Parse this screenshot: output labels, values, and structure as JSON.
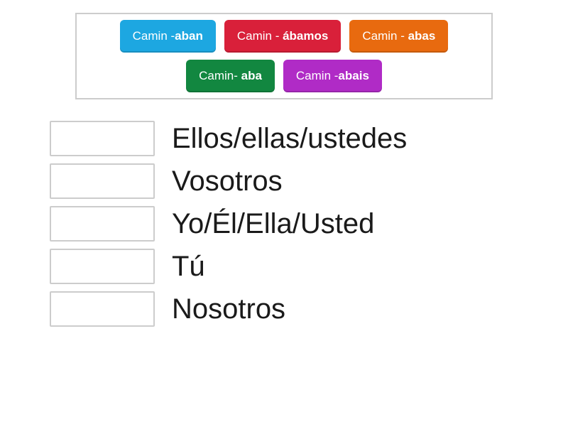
{
  "tiles": [
    {
      "prefix": "Camin -",
      "suffix": "aban",
      "color": "blue"
    },
    {
      "prefix": "Camin - ",
      "suffix": "ábamos",
      "color": "red"
    },
    {
      "prefix": "Camin - ",
      "suffix": "abas",
      "color": "orange"
    },
    {
      "prefix": "Camin- ",
      "suffix": "aba",
      "color": "green"
    },
    {
      "prefix": "Camin -",
      "suffix": "abais",
      "color": "purple"
    }
  ],
  "prompts": [
    "Ellos/ellas/ustedes",
    "Vosotros",
    "Yo/Él/Ella/Usted",
    "Tú",
    "Nosotros"
  ]
}
